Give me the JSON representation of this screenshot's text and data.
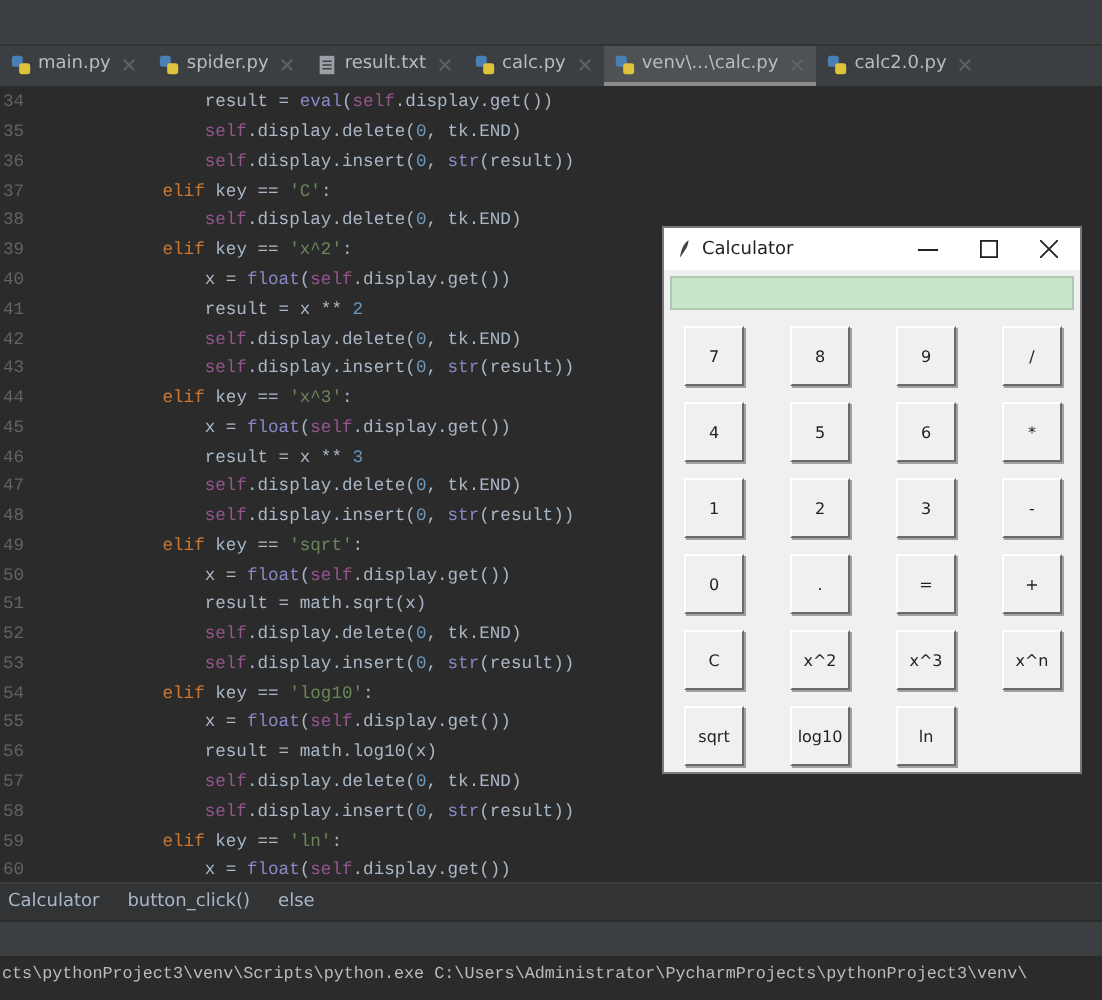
{
  "tabs": [
    {
      "label": "main.py",
      "kind": "python",
      "selected": false
    },
    {
      "label": "spider.py",
      "kind": "python",
      "selected": false
    },
    {
      "label": "result.txt",
      "kind": "text",
      "selected": false
    },
    {
      "label": "calc.py",
      "kind": "python",
      "selected": false
    },
    {
      "label": "venv\\...\\calc.py",
      "kind": "python",
      "selected": true
    },
    {
      "label": "calc2.0.py",
      "kind": "python",
      "selected": false
    }
  ],
  "code_lines": [
    {
      "number": "34",
      "tokens": [
        {
          "t": "            result = ",
          "kind": "plain"
        },
        {
          "t": "eval",
          "kind": "builtin"
        },
        {
          "t": "(",
          "kind": "plain"
        },
        {
          "t": "self",
          "kind": "self"
        },
        {
          "t": ".display.get())",
          "kind": "plain"
        }
      ]
    },
    {
      "number": "35",
      "tokens": [
        {
          "t": "            self",
          "kind": "self"
        },
        {
          "t": ".display.delete(",
          "kind": "plain"
        },
        {
          "t": "0",
          "kind": "num"
        },
        {
          "t": ", tk.END)",
          "kind": "plain"
        }
      ]
    },
    {
      "number": "36",
      "tokens": [
        {
          "t": "            self",
          "kind": "self"
        },
        {
          "t": ".display.insert(",
          "kind": "plain"
        },
        {
          "t": "0",
          "kind": "num"
        },
        {
          "t": ", ",
          "kind": "plain"
        },
        {
          "t": "str",
          "kind": "builtin"
        },
        {
          "t": "(result))",
          "kind": "plain"
        }
      ]
    },
    {
      "number": "37",
      "tokens": [
        {
          "t": "        elif",
          "kind": "kw"
        },
        {
          "t": " key == ",
          "kind": "plain"
        },
        {
          "t": "'C'",
          "kind": "str"
        },
        {
          "t": ":",
          "kind": "plain"
        }
      ]
    },
    {
      "number": "38",
      "tokens": [
        {
          "t": "            self",
          "kind": "self"
        },
        {
          "t": ".display.delete(",
          "kind": "plain"
        },
        {
          "t": "0",
          "kind": "num"
        },
        {
          "t": ", tk.END)",
          "kind": "plain"
        }
      ]
    },
    {
      "number": "39",
      "tokens": [
        {
          "t": "        elif",
          "kind": "kw"
        },
        {
          "t": " key == ",
          "kind": "plain"
        },
        {
          "t": "'x^2'",
          "kind": "str"
        },
        {
          "t": ":",
          "kind": "plain"
        }
      ]
    },
    {
      "number": "40",
      "tokens": [
        {
          "t": "            x = ",
          "kind": "plain"
        },
        {
          "t": "float",
          "kind": "builtin"
        },
        {
          "t": "(",
          "kind": "plain"
        },
        {
          "t": "self",
          "kind": "self"
        },
        {
          "t": ".display.get())",
          "kind": "plain"
        }
      ]
    },
    {
      "number": "41",
      "tokens": [
        {
          "t": "            result = x ** ",
          "kind": "plain"
        },
        {
          "t": "2",
          "kind": "num"
        }
      ]
    },
    {
      "number": "42",
      "tokens": [
        {
          "t": "            self",
          "kind": "self"
        },
        {
          "t": ".display.delete(",
          "kind": "plain"
        },
        {
          "t": "0",
          "kind": "num"
        },
        {
          "t": ", tk.END)",
          "kind": "plain"
        }
      ]
    },
    {
      "number": "43",
      "tokens": [
        {
          "t": "            self",
          "kind": "self"
        },
        {
          "t": ".display.insert(",
          "kind": "plain"
        },
        {
          "t": "0",
          "kind": "num"
        },
        {
          "t": ", ",
          "kind": "plain"
        },
        {
          "t": "str",
          "kind": "builtin"
        },
        {
          "t": "(result))",
          "kind": "plain"
        }
      ]
    },
    {
      "number": "44",
      "tokens": [
        {
          "t": "        elif",
          "kind": "kw"
        },
        {
          "t": " key == ",
          "kind": "plain"
        },
        {
          "t": "'x^3'",
          "kind": "str"
        },
        {
          "t": ":",
          "kind": "plain"
        }
      ]
    },
    {
      "number": "45",
      "tokens": [
        {
          "t": "            x = ",
          "kind": "plain"
        },
        {
          "t": "float",
          "kind": "builtin"
        },
        {
          "t": "(",
          "kind": "plain"
        },
        {
          "t": "self",
          "kind": "self"
        },
        {
          "t": ".display.get())",
          "kind": "plain"
        }
      ]
    },
    {
      "number": "46",
      "tokens": [
        {
          "t": "            result = x ** ",
          "kind": "plain"
        },
        {
          "t": "3",
          "kind": "num"
        }
      ]
    },
    {
      "number": "47",
      "tokens": [
        {
          "t": "            self",
          "kind": "self"
        },
        {
          "t": ".display.delete(",
          "kind": "plain"
        },
        {
          "t": "0",
          "kind": "num"
        },
        {
          "t": ", tk.END)",
          "kind": "plain"
        }
      ]
    },
    {
      "number": "48",
      "tokens": [
        {
          "t": "            self",
          "kind": "self"
        },
        {
          "t": ".display.insert(",
          "kind": "plain"
        },
        {
          "t": "0",
          "kind": "num"
        },
        {
          "t": ", ",
          "kind": "plain"
        },
        {
          "t": "str",
          "kind": "builtin"
        },
        {
          "t": "(result))",
          "kind": "plain"
        }
      ]
    },
    {
      "number": "49",
      "tokens": [
        {
          "t": "        elif",
          "kind": "kw"
        },
        {
          "t": " key == ",
          "kind": "plain"
        },
        {
          "t": "'sqrt'",
          "kind": "str"
        },
        {
          "t": ":",
          "kind": "plain"
        }
      ]
    },
    {
      "number": "50",
      "tokens": [
        {
          "t": "            x = ",
          "kind": "plain"
        },
        {
          "t": "float",
          "kind": "builtin"
        },
        {
          "t": "(",
          "kind": "plain"
        },
        {
          "t": "self",
          "kind": "self"
        },
        {
          "t": ".display.get())",
          "kind": "plain"
        }
      ]
    },
    {
      "number": "51",
      "tokens": [
        {
          "t": "            result = math.sqrt(x)",
          "kind": "plain"
        }
      ]
    },
    {
      "number": "52",
      "tokens": [
        {
          "t": "            self",
          "kind": "self"
        },
        {
          "t": ".display.delete(",
          "kind": "plain"
        },
        {
          "t": "0",
          "kind": "num"
        },
        {
          "t": ", tk.END)",
          "kind": "plain"
        }
      ]
    },
    {
      "number": "53",
      "tokens": [
        {
          "t": "            self",
          "kind": "self"
        },
        {
          "t": ".display.insert(",
          "kind": "plain"
        },
        {
          "t": "0",
          "kind": "num"
        },
        {
          "t": ", ",
          "kind": "plain"
        },
        {
          "t": "str",
          "kind": "builtin"
        },
        {
          "t": "(result))",
          "kind": "plain"
        }
      ]
    },
    {
      "number": "54",
      "tokens": [
        {
          "t": "        elif",
          "kind": "kw"
        },
        {
          "t": " key == ",
          "kind": "plain"
        },
        {
          "t": "'log10'",
          "kind": "str"
        },
        {
          "t": ":",
          "kind": "plain"
        }
      ]
    },
    {
      "number": "55",
      "tokens": [
        {
          "t": "            x = ",
          "kind": "plain"
        },
        {
          "t": "float",
          "kind": "builtin"
        },
        {
          "t": "(",
          "kind": "plain"
        },
        {
          "t": "self",
          "kind": "self"
        },
        {
          "t": ".display.get())",
          "kind": "plain"
        }
      ]
    },
    {
      "number": "56",
      "tokens": [
        {
          "t": "            result = math.log10(x)",
          "kind": "plain"
        }
      ]
    },
    {
      "number": "57",
      "tokens": [
        {
          "t": "            self",
          "kind": "self"
        },
        {
          "t": ".display.delete(",
          "kind": "plain"
        },
        {
          "t": "0",
          "kind": "num"
        },
        {
          "t": ", tk.END)",
          "kind": "plain"
        }
      ]
    },
    {
      "number": "58",
      "tokens": [
        {
          "t": "            self",
          "kind": "self"
        },
        {
          "t": ".display.insert(",
          "kind": "plain"
        },
        {
          "t": "0",
          "kind": "num"
        },
        {
          "t": ", ",
          "kind": "plain"
        },
        {
          "t": "str",
          "kind": "builtin"
        },
        {
          "t": "(result))",
          "kind": "plain"
        }
      ]
    },
    {
      "number": "59",
      "tokens": [
        {
          "t": "        elif",
          "kind": "kw"
        },
        {
          "t": " key == ",
          "kind": "plain"
        },
        {
          "t": "'ln'",
          "kind": "str"
        },
        {
          "t": ":",
          "kind": "plain"
        }
      ]
    },
    {
      "number": "60",
      "tokens": [
        {
          "t": "            x = ",
          "kind": "plain"
        },
        {
          "t": "float",
          "kind": "builtin"
        },
        {
          "t": "(",
          "kind": "plain"
        },
        {
          "t": "self",
          "kind": "self"
        },
        {
          "t": ".display.get())",
          "kind": "plain"
        }
      ]
    }
  ],
  "breadcrumbs": [
    "Calculator",
    "button_click()",
    "else"
  ],
  "console_line": "cts\\pythonProject3\\venv\\Scripts\\python.exe C:\\Users\\Administrator\\PycharmProjects\\pythonProject3\\venv\\",
  "calculator": {
    "title": "Calculator",
    "buttons": [
      "7",
      "8",
      "9",
      "/",
      "4",
      "5",
      "6",
      "*",
      "1",
      "2",
      "3",
      "-",
      "0",
      ".",
      "=",
      "+",
      "C",
      "x^2",
      "x^3",
      "x^n",
      "sqrt",
      "log10",
      "ln"
    ]
  }
}
